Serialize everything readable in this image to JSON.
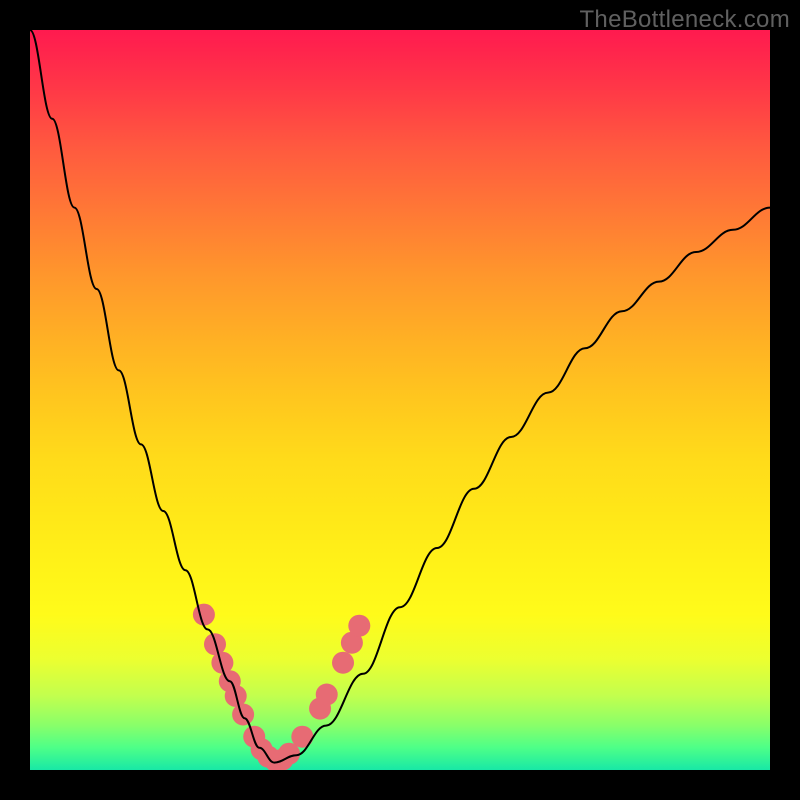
{
  "watermark": "TheBottleneck.com",
  "chart_data": {
    "type": "line",
    "title": "",
    "xlabel": "",
    "ylabel": "",
    "xlim": [
      0,
      100
    ],
    "ylim": [
      0,
      100
    ],
    "grid": false,
    "legend": false,
    "series": [
      {
        "name": "bottleneck-curve",
        "x": [
          0,
          3,
          6,
          9,
          12,
          15,
          18,
          21,
          24,
          27,
          29,
          31,
          33,
          36,
          40,
          45,
          50,
          55,
          60,
          65,
          70,
          75,
          80,
          85,
          90,
          95,
          100
        ],
        "y": [
          100,
          88,
          76,
          65,
          54,
          44,
          35,
          27,
          19,
          12,
          7,
          3,
          1,
          2,
          6,
          13,
          22,
          30,
          38,
          45,
          51,
          57,
          62,
          66,
          70,
          73,
          76
        ],
        "color": "#000000",
        "linewidth": 2
      }
    ],
    "markers": {
      "name": "highlight-points",
      "color": "#e76b74",
      "radius": 11,
      "points": [
        {
          "x": 23.5,
          "y": 21
        },
        {
          "x": 25,
          "y": 17
        },
        {
          "x": 26,
          "y": 14.5
        },
        {
          "x": 27,
          "y": 12
        },
        {
          "x": 27.8,
          "y": 10
        },
        {
          "x": 28.8,
          "y": 7.5
        },
        {
          "x": 30.3,
          "y": 4.5
        },
        {
          "x": 31.3,
          "y": 2.8
        },
        {
          "x": 32.2,
          "y": 1.8
        },
        {
          "x": 33.2,
          "y": 1.2
        },
        {
          "x": 34.1,
          "y": 1.4
        },
        {
          "x": 35.0,
          "y": 2.2
        },
        {
          "x": 36.8,
          "y": 4.5
        },
        {
          "x": 39.2,
          "y": 8.3
        },
        {
          "x": 40.1,
          "y": 10.2
        },
        {
          "x": 42.3,
          "y": 14.5
        },
        {
          "x": 43.5,
          "y": 17.2
        },
        {
          "x": 44.5,
          "y": 19.5
        }
      ]
    }
  }
}
